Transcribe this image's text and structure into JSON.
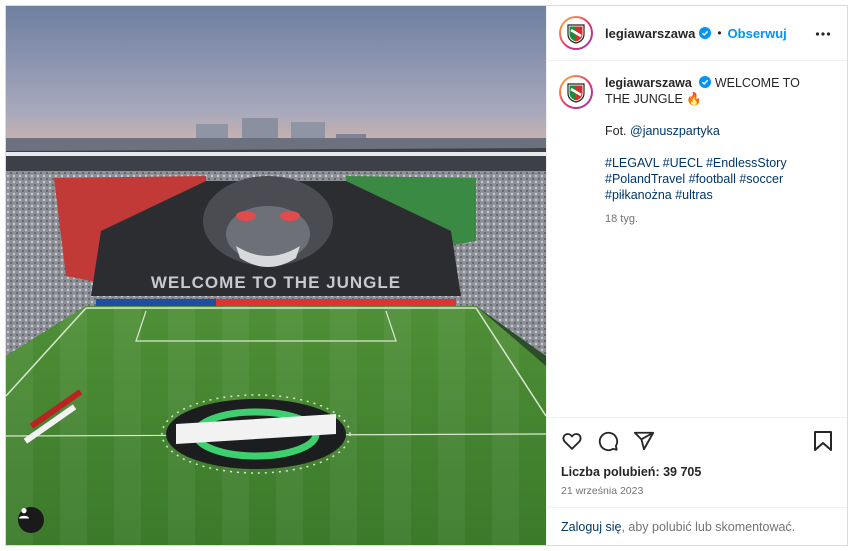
{
  "post": {
    "username": "legiawarszawa",
    "follow_label": "Obserwuj",
    "separator": "•",
    "banner_text": "WELCOME TO THE JUNGLE"
  },
  "caption": {
    "username": "legiawarszawa",
    "title": "WELCOME TO THE JUNGLE 🔥",
    "photo_prefix": "Fot. ",
    "photo_credit": "@januszpartyka",
    "hashtags_line1": "#LEGAVL #UECL #EndlessStory",
    "hashtags_line2": "#PolandTravel #football #soccer",
    "hashtags_line3": "#piłkanożna #ultras",
    "age": "18 tyg."
  },
  "stats": {
    "likes": "Liczba polubień: 39 705",
    "date": "21 września 2023"
  },
  "login": {
    "link": "Zaloguj się",
    "rest": ", aby polubić lub skomentować."
  },
  "colors": {
    "accent": "#0095f6",
    "link": "#00376b",
    "muted": "#737373",
    "border": "#dbdbdb"
  },
  "icons": [
    "verified-icon",
    "more-icon",
    "heart-icon",
    "comment-icon",
    "share-icon",
    "bookmark-icon",
    "user-tag-icon"
  ]
}
